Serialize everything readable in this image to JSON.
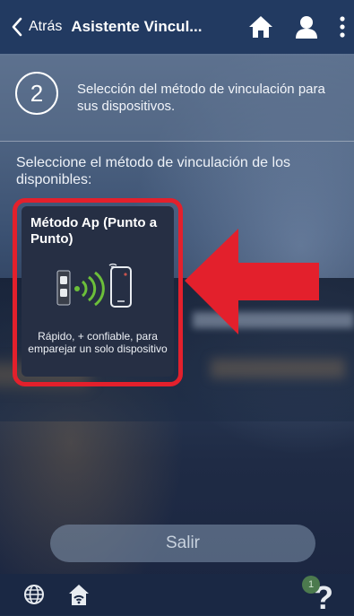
{
  "header": {
    "back_label": "Atrás",
    "title": "Asistente Vincul...",
    "icons": [
      "home-icon",
      "user-icon",
      "more-vertical-icon"
    ]
  },
  "step": {
    "number": "2",
    "text": "Selección del método de vinculación para sus dispositivos."
  },
  "instruction": "Seleccione el método de vinculación de los disponibles:",
  "method_card": {
    "title": "Método Ap (Punto a Punto)",
    "description": "Rápido, + confiable, para emparejar un solo dispositivo",
    "icon": "ap-pairing-icon",
    "highlight_color": "#e3202c"
  },
  "exit_button": {
    "label": "Salir"
  },
  "footer": {
    "icons": [
      "globe-icon",
      "home-wifi-icon",
      "help-icon"
    ],
    "help_badge": "1"
  },
  "colors": {
    "topbar": "#223a61",
    "accent_red": "#e3202c",
    "wave_green": "#6cbf3a"
  }
}
